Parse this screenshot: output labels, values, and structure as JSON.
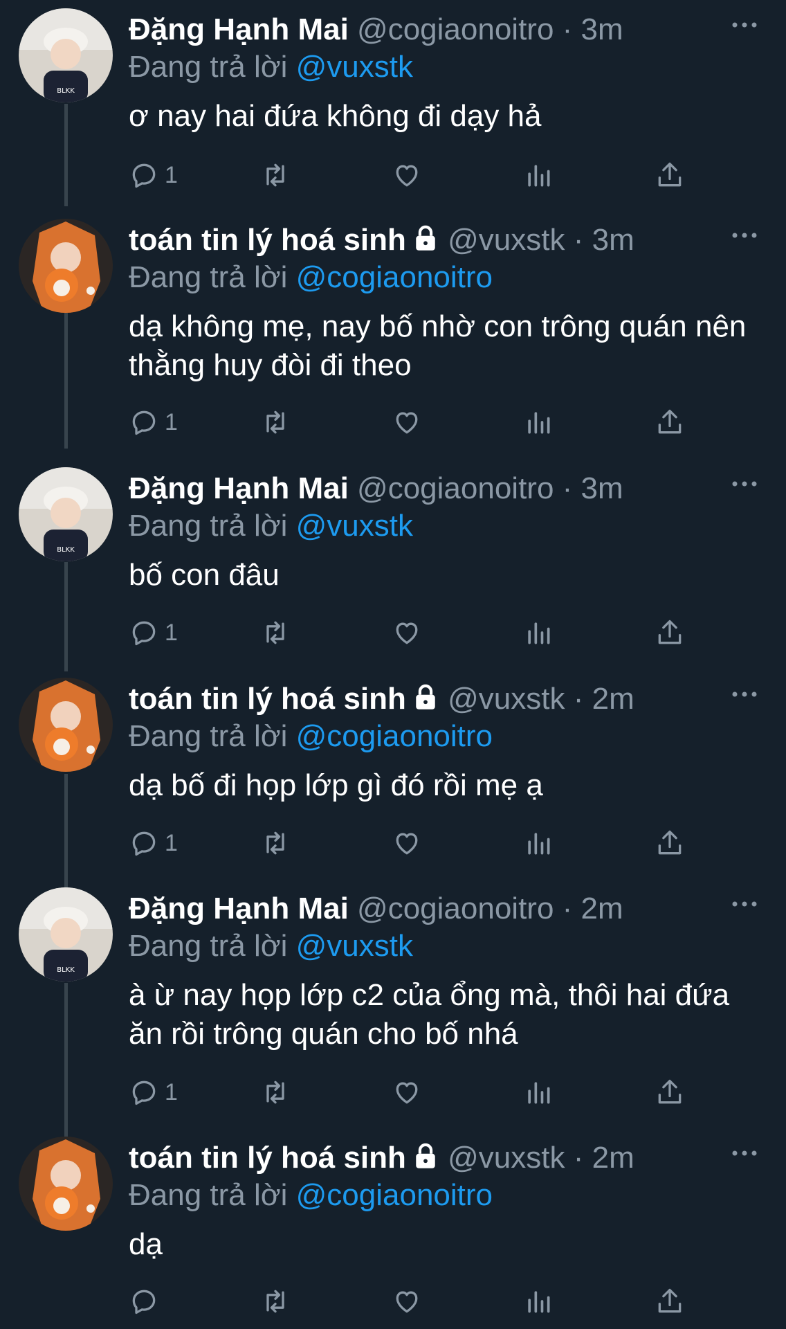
{
  "tweets": [
    {
      "name": "Đặng Hạnh Mai",
      "handle": "@cogiaonoitro",
      "separator": "·",
      "time": "3m",
      "replying_prefix": "Đang trả lời",
      "replying_to": "@vuxstk",
      "text": "ơ nay hai đứa không đi dạy hả",
      "reply_count": "1",
      "locked": false
    },
    {
      "name": "toán tin lý hoá sinh",
      "handle": "@vuxstk",
      "separator": "·",
      "time": "3m",
      "replying_prefix": "Đang trả lời",
      "replying_to": "@cogiaonoitro",
      "text": "dạ không mẹ, nay bố nhờ con trông quán nên thằng huy đòi đi theo",
      "reply_count": "1",
      "locked": true
    },
    {
      "name": "Đặng Hạnh Mai",
      "handle": "@cogiaonoitro",
      "separator": "·",
      "time": "3m",
      "replying_prefix": "Đang trả lời",
      "replying_to": "@vuxstk",
      "text": "bố con đâu",
      "reply_count": "1",
      "locked": false
    },
    {
      "name": "toán tin lý hoá sinh",
      "handle": "@vuxstk",
      "separator": "·",
      "time": "2m",
      "replying_prefix": "Đang trả lời",
      "replying_to": "@cogiaonoitro",
      "text": "dạ bố đi họp lớp gì đó rồi mẹ ạ",
      "reply_count": "1",
      "locked": true
    },
    {
      "name": "Đặng Hạnh Mai",
      "handle": "@cogiaonoitro",
      "separator": "·",
      "time": "2m",
      "replying_prefix": "Đang trả lời",
      "replying_to": "@vuxstk",
      "text": "à ừ nay họp lớp c2 của ổng mà, thôi hai đứa ăn rồi trông quán cho bố nhá",
      "reply_count": "1",
      "locked": false
    },
    {
      "name": "toán tin lý hoá sinh",
      "handle": "@vuxstk",
      "separator": "·",
      "time": "2m",
      "replying_prefix": "Đang trả lời",
      "replying_to": "@cogiaonoitro",
      "text": "dạ",
      "reply_count": "",
      "locked": true
    }
  ],
  "icons": {
    "reply": "reply-icon",
    "retweet": "retweet-icon",
    "like": "heart-icon",
    "views": "analytics-icon",
    "share": "share-icon",
    "more": "more-icon",
    "lock": "lock-icon"
  },
  "colors": {
    "background": "#15202b",
    "text": "#ffffff",
    "muted": "#8b98a5",
    "link": "#1d9bf0",
    "thread_line": "#38444d"
  }
}
